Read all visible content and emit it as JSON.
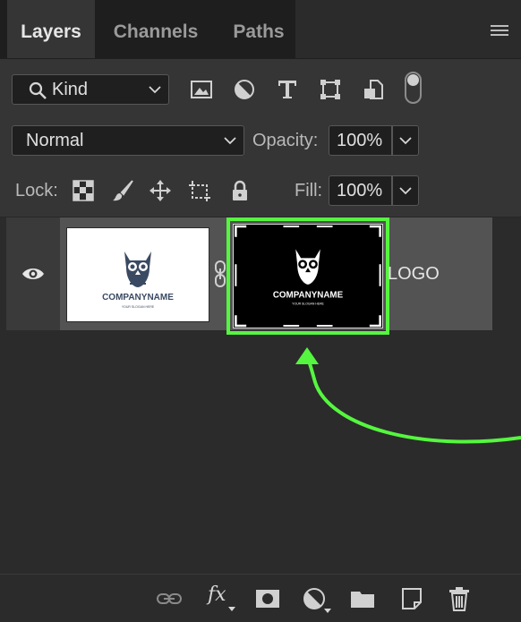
{
  "tabs": [
    {
      "label": "Layers",
      "active": true
    },
    {
      "label": "Channels",
      "active": false
    },
    {
      "label": "Paths",
      "active": false
    }
  ],
  "filter": {
    "kind_label": "Kind",
    "icons": [
      "image-filter-icon",
      "adjustment-filter-icon",
      "type-filter-icon",
      "shape-filter-icon",
      "smart-object-filter-icon"
    ]
  },
  "blend": {
    "mode": "Normal",
    "opacity_label": "Opacity:",
    "opacity_value": "100%"
  },
  "locks": {
    "lock_label": "Lock:",
    "fill_label": "Fill:",
    "fill_value": "100%",
    "icons": [
      "lock-transparent-icon",
      "lock-paint-icon",
      "lock-position-icon",
      "lock-artboard-icon",
      "lock-all-icon"
    ]
  },
  "layer": {
    "name": "LOGO",
    "thumbnail_text": "COMPANYNAME",
    "thumbnail_subtext": "YOUR SLOGAN HERE"
  },
  "colors": {
    "highlight": "#55f63f",
    "panel": "#353535",
    "background": "#2b2b2b"
  },
  "bottom_icons": [
    "link-layers-icon",
    "fx-icon",
    "add-mask-icon",
    "adjustment-layer-icon",
    "group-folder-icon",
    "new-layer-icon",
    "trash-icon"
  ],
  "bottom": {
    "fx_label": "fx"
  }
}
